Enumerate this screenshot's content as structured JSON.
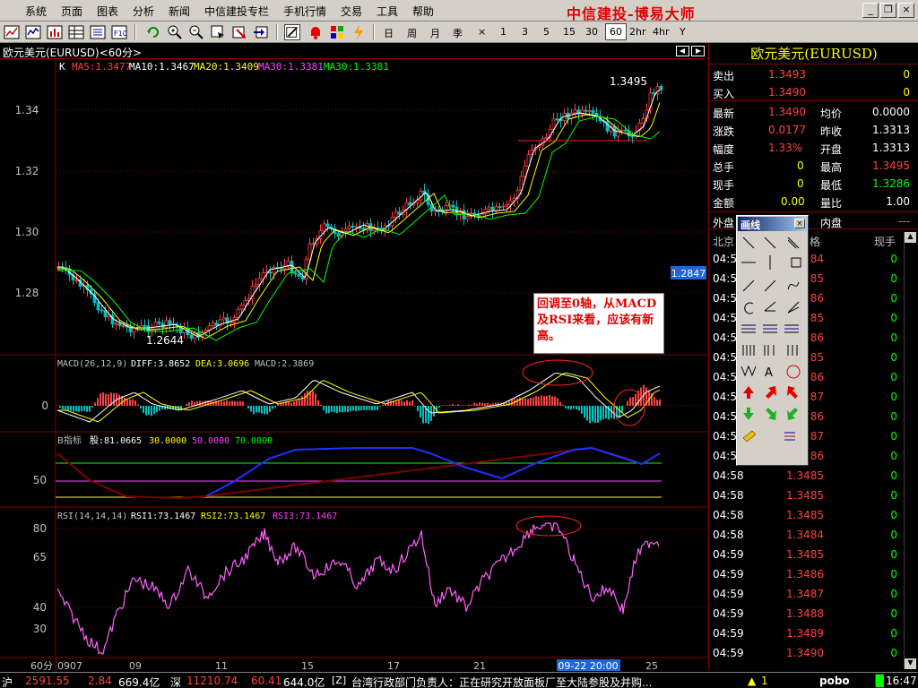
{
  "menu": {
    "items": [
      "系统",
      "页面",
      "图表",
      "分析",
      "新闻",
      "中信建投专栏",
      "手机行情",
      "交易",
      "工具",
      "帮助"
    ],
    "brand": "中信建投-博易大师"
  },
  "toolbar": {
    "periods": [
      "日",
      "周",
      "月",
      "季",
      "×",
      "1",
      "3",
      "5",
      "15",
      "30",
      "60",
      "2hr",
      "4hr",
      "Y"
    ],
    "active_period": "60"
  },
  "chart": {
    "title": "欧元美元(EURUSD)<60分>",
    "ma_line": {
      "k": "K",
      "ma5": "MA5:1.3477",
      "ma10": "MA10:1.3467",
      "ma20": "MA20:1.3409",
      "ma30a": "MA30:1.3381",
      "ma30b": "MA30:1.3381"
    },
    "price_axis": [
      "1.34",
      "1.32",
      "1.30",
      "1.28"
    ],
    "high_label": "1.3495",
    "low_label": "1.2644",
    "current_price": "1.2847",
    "macd_line": {
      "name": "MACD(26,12,9)",
      "diff": "DIFF:3.8652",
      "dea": "DEA:3.0696",
      "macd": "MACD:2.3869"
    },
    "macd_axis": "0",
    "b_line": {
      "name": "B指标",
      "gu": "股:81.0665",
      "v1": "30.0000",
      "v2": "50.0000",
      "v3": "70.0000"
    },
    "b_axis": "50",
    "rsi_line": {
      "name": "RSI(14,14,14)",
      "rsi1": "RSI1:73.1467",
      "rsi2": "RSI2:73.1467",
      "rsi3": "RSI3:73.1467"
    },
    "rsi_axis": [
      "80",
      "65",
      "40",
      "30"
    ],
    "x_axis": {
      "period": "60分",
      "labels": [
        "0907",
        "09",
        "11",
        "15",
        "17",
        "21",
        "25"
      ],
      "cursor": "09-22 20:00"
    },
    "colors": {
      "candle_up": "#ff4040",
      "candle_down": "#00c0c0",
      "ma5": "#ffffff",
      "ma10": "#ffff00",
      "ma20": "#ff00ff",
      "ma30": "#00ff00",
      "grid": "#800000"
    }
  },
  "annotation": {
    "text": "回调至0轴，从MACD及RSI来看，应该有新高。"
  },
  "quote": {
    "title": "欧元美元(EURUSD)",
    "sell_label": "卖出",
    "sell_price": "1.3493",
    "sell_vol": "0",
    "buy_label": "买入",
    "buy_price": "1.3490",
    "buy_vol": "0",
    "rows": [
      {
        "l1": "最新",
        "v1": "1.3490",
        "l2": "均价",
        "v2": "0.0000"
      },
      {
        "l1": "涨跌",
        "v1": "0.0177",
        "l2": "昨收",
        "v2": "1.3313"
      },
      {
        "l1": "幅度",
        "v1": "1.33%",
        "l2": "开盘",
        "v2": "1.3313"
      },
      {
        "l1": "总手",
        "v1": "0",
        "l2": "最高",
        "v2": "1.3495"
      },
      {
        "l1": "现手",
        "v1": "0",
        "l2": "最低",
        "v2": "1.3286"
      },
      {
        "l1": "金额",
        "v1": "0.00",
        "l2": "量比",
        "v2": "1.00"
      }
    ],
    "outer_label": "外盘",
    "inner_label": "内盘",
    "inner_value": "---",
    "tick_header": {
      "time": "北京",
      "price": "格",
      "vol": "现手"
    },
    "ticks": [
      {
        "t": "04:5",
        "p": "84",
        "v": "0"
      },
      {
        "t": "04:5",
        "p": "85",
        "v": "0"
      },
      {
        "t": "04:5",
        "p": "86",
        "v": "0"
      },
      {
        "t": "04:5",
        "p": "85",
        "v": "0"
      },
      {
        "t": "04:5",
        "p": "86",
        "v": "0"
      },
      {
        "t": "04:5",
        "p": "85",
        "v": "0"
      },
      {
        "t": "04:5",
        "p": "86",
        "v": "0"
      },
      {
        "t": "04:5",
        "p": "87",
        "v": "0"
      },
      {
        "t": "04:5",
        "p": "86",
        "v": "0"
      },
      {
        "t": "04:5",
        "p": "87",
        "v": "0"
      },
      {
        "t": "04:5",
        "p": "86",
        "v": "0"
      },
      {
        "t": "04:58",
        "p": "1.3485",
        "v": "0"
      },
      {
        "t": "04:58",
        "p": "1.3485",
        "v": "0"
      },
      {
        "t": "04:58",
        "p": "1.3485",
        "v": "0"
      },
      {
        "t": "04:58",
        "p": "1.3484",
        "v": "0"
      },
      {
        "t": "04:59",
        "p": "1.3485",
        "v": "0"
      },
      {
        "t": "04:59",
        "p": "1.3486",
        "v": "0"
      },
      {
        "t": "04:59",
        "p": "1.3487",
        "v": "0"
      },
      {
        "t": "04:59",
        "p": "1.3488",
        "v": "0"
      },
      {
        "t": "04:59",
        "p": "1.3489",
        "v": "0"
      },
      {
        "t": "04:59",
        "p": "1.3490",
        "v": "0"
      }
    ]
  },
  "palette": {
    "title": "画线",
    "close": "×",
    "text_tool": "A"
  },
  "statusbar": {
    "sh_label": "沪",
    "sh_index": "2591.55",
    "sh_change": "2.84",
    "sh_amount": "669.4亿",
    "sz_label": "深",
    "sz_index": "11210.74",
    "sz_change": "60.41",
    "sz_amount": "644.0亿",
    "news_icon": "[Z]",
    "news": "台湾行政部门负责人：正在研究开放面板厂至大陆参股及并购...",
    "alert_count": "1",
    "pobo": "pobo",
    "time": "16:47"
  }
}
